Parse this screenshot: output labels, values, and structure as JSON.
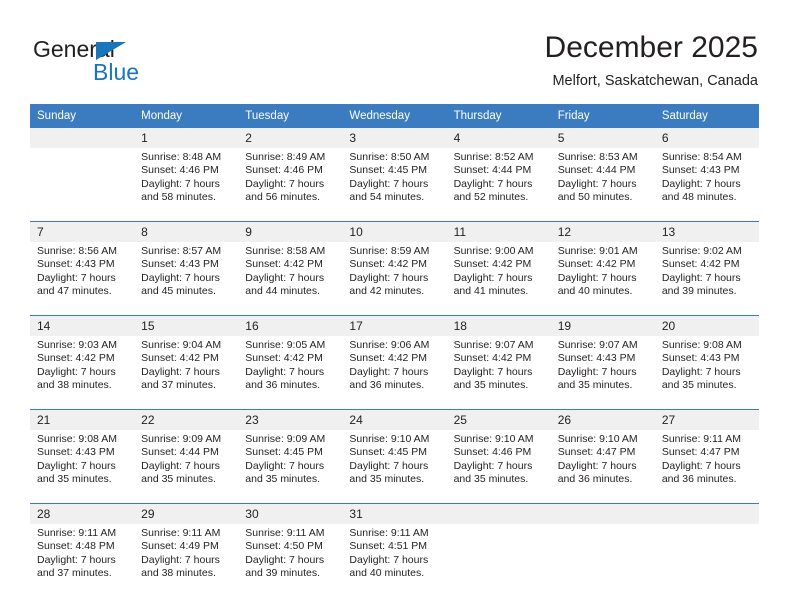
{
  "brand": {
    "name_top": "General",
    "name_bottom": "Blue",
    "triangle_color": "#1b75bb",
    "text_color": "#221f20"
  },
  "header": {
    "title": "December 2025",
    "subtitle": "Melfort, Saskatchewan, Canada"
  },
  "calendar": {
    "header_bg": "#3b7bbf",
    "daynum_bg": "#f0f0f0",
    "separator_color": "#3b7bbf",
    "weekdays": [
      "Sunday",
      "Monday",
      "Tuesday",
      "Wednesday",
      "Thursday",
      "Friday",
      "Saturday"
    ],
    "weeks": [
      [
        {
          "day": "",
          "sunrise": "",
          "sunset": "",
          "daylight1": "",
          "daylight2": ""
        },
        {
          "day": "1",
          "sunrise": "Sunrise: 8:48 AM",
          "sunset": "Sunset: 4:46 PM",
          "daylight1": "Daylight: 7 hours",
          "daylight2": "and 58 minutes."
        },
        {
          "day": "2",
          "sunrise": "Sunrise: 8:49 AM",
          "sunset": "Sunset: 4:46 PM",
          "daylight1": "Daylight: 7 hours",
          "daylight2": "and 56 minutes."
        },
        {
          "day": "3",
          "sunrise": "Sunrise: 8:50 AM",
          "sunset": "Sunset: 4:45 PM",
          "daylight1": "Daylight: 7 hours",
          "daylight2": "and 54 minutes."
        },
        {
          "day": "4",
          "sunrise": "Sunrise: 8:52 AM",
          "sunset": "Sunset: 4:44 PM",
          "daylight1": "Daylight: 7 hours",
          "daylight2": "and 52 minutes."
        },
        {
          "day": "5",
          "sunrise": "Sunrise: 8:53 AM",
          "sunset": "Sunset: 4:44 PM",
          "daylight1": "Daylight: 7 hours",
          "daylight2": "and 50 minutes."
        },
        {
          "day": "6",
          "sunrise": "Sunrise: 8:54 AM",
          "sunset": "Sunset: 4:43 PM",
          "daylight1": "Daylight: 7 hours",
          "daylight2": "and 48 minutes."
        }
      ],
      [
        {
          "day": "7",
          "sunrise": "Sunrise: 8:56 AM",
          "sunset": "Sunset: 4:43 PM",
          "daylight1": "Daylight: 7 hours",
          "daylight2": "and 47 minutes."
        },
        {
          "day": "8",
          "sunrise": "Sunrise: 8:57 AM",
          "sunset": "Sunset: 4:43 PM",
          "daylight1": "Daylight: 7 hours",
          "daylight2": "and 45 minutes."
        },
        {
          "day": "9",
          "sunrise": "Sunrise: 8:58 AM",
          "sunset": "Sunset: 4:42 PM",
          "daylight1": "Daylight: 7 hours",
          "daylight2": "and 44 minutes."
        },
        {
          "day": "10",
          "sunrise": "Sunrise: 8:59 AM",
          "sunset": "Sunset: 4:42 PM",
          "daylight1": "Daylight: 7 hours",
          "daylight2": "and 42 minutes."
        },
        {
          "day": "11",
          "sunrise": "Sunrise: 9:00 AM",
          "sunset": "Sunset: 4:42 PM",
          "daylight1": "Daylight: 7 hours",
          "daylight2": "and 41 minutes."
        },
        {
          "day": "12",
          "sunrise": "Sunrise: 9:01 AM",
          "sunset": "Sunset: 4:42 PM",
          "daylight1": "Daylight: 7 hours",
          "daylight2": "and 40 minutes."
        },
        {
          "day": "13",
          "sunrise": "Sunrise: 9:02 AM",
          "sunset": "Sunset: 4:42 PM",
          "daylight1": "Daylight: 7 hours",
          "daylight2": "and 39 minutes."
        }
      ],
      [
        {
          "day": "14",
          "sunrise": "Sunrise: 9:03 AM",
          "sunset": "Sunset: 4:42 PM",
          "daylight1": "Daylight: 7 hours",
          "daylight2": "and 38 minutes."
        },
        {
          "day": "15",
          "sunrise": "Sunrise: 9:04 AM",
          "sunset": "Sunset: 4:42 PM",
          "daylight1": "Daylight: 7 hours",
          "daylight2": "and 37 minutes."
        },
        {
          "day": "16",
          "sunrise": "Sunrise: 9:05 AM",
          "sunset": "Sunset: 4:42 PM",
          "daylight1": "Daylight: 7 hours",
          "daylight2": "and 36 minutes."
        },
        {
          "day": "17",
          "sunrise": "Sunrise: 9:06 AM",
          "sunset": "Sunset: 4:42 PM",
          "daylight1": "Daylight: 7 hours",
          "daylight2": "and 36 minutes."
        },
        {
          "day": "18",
          "sunrise": "Sunrise: 9:07 AM",
          "sunset": "Sunset: 4:42 PM",
          "daylight1": "Daylight: 7 hours",
          "daylight2": "and 35 minutes."
        },
        {
          "day": "19",
          "sunrise": "Sunrise: 9:07 AM",
          "sunset": "Sunset: 4:43 PM",
          "daylight1": "Daylight: 7 hours",
          "daylight2": "and 35 minutes."
        },
        {
          "day": "20",
          "sunrise": "Sunrise: 9:08 AM",
          "sunset": "Sunset: 4:43 PM",
          "daylight1": "Daylight: 7 hours",
          "daylight2": "and 35 minutes."
        }
      ],
      [
        {
          "day": "21",
          "sunrise": "Sunrise: 9:08 AM",
          "sunset": "Sunset: 4:43 PM",
          "daylight1": "Daylight: 7 hours",
          "daylight2": "and 35 minutes."
        },
        {
          "day": "22",
          "sunrise": "Sunrise: 9:09 AM",
          "sunset": "Sunset: 4:44 PM",
          "daylight1": "Daylight: 7 hours",
          "daylight2": "and 35 minutes."
        },
        {
          "day": "23",
          "sunrise": "Sunrise: 9:09 AM",
          "sunset": "Sunset: 4:45 PM",
          "daylight1": "Daylight: 7 hours",
          "daylight2": "and 35 minutes."
        },
        {
          "day": "24",
          "sunrise": "Sunrise: 9:10 AM",
          "sunset": "Sunset: 4:45 PM",
          "daylight1": "Daylight: 7 hours",
          "daylight2": "and 35 minutes."
        },
        {
          "day": "25",
          "sunrise": "Sunrise: 9:10 AM",
          "sunset": "Sunset: 4:46 PM",
          "daylight1": "Daylight: 7 hours",
          "daylight2": "and 35 minutes."
        },
        {
          "day": "26",
          "sunrise": "Sunrise: 9:10 AM",
          "sunset": "Sunset: 4:47 PM",
          "daylight1": "Daylight: 7 hours",
          "daylight2": "and 36 minutes."
        },
        {
          "day": "27",
          "sunrise": "Sunrise: 9:11 AM",
          "sunset": "Sunset: 4:47 PM",
          "daylight1": "Daylight: 7 hours",
          "daylight2": "and 36 minutes."
        }
      ],
      [
        {
          "day": "28",
          "sunrise": "Sunrise: 9:11 AM",
          "sunset": "Sunset: 4:48 PM",
          "daylight1": "Daylight: 7 hours",
          "daylight2": "and 37 minutes."
        },
        {
          "day": "29",
          "sunrise": "Sunrise: 9:11 AM",
          "sunset": "Sunset: 4:49 PM",
          "daylight1": "Daylight: 7 hours",
          "daylight2": "and 38 minutes."
        },
        {
          "day": "30",
          "sunrise": "Sunrise: 9:11 AM",
          "sunset": "Sunset: 4:50 PM",
          "daylight1": "Daylight: 7 hours",
          "daylight2": "and 39 minutes."
        },
        {
          "day": "31",
          "sunrise": "Sunrise: 9:11 AM",
          "sunset": "Sunset: 4:51 PM",
          "daylight1": "Daylight: 7 hours",
          "daylight2": "and 40 minutes."
        },
        {
          "day": "",
          "sunrise": "",
          "sunset": "",
          "daylight1": "",
          "daylight2": ""
        },
        {
          "day": "",
          "sunrise": "",
          "sunset": "",
          "daylight1": "",
          "daylight2": ""
        },
        {
          "day": "",
          "sunrise": "",
          "sunset": "",
          "daylight1": "",
          "daylight2": ""
        }
      ]
    ]
  }
}
